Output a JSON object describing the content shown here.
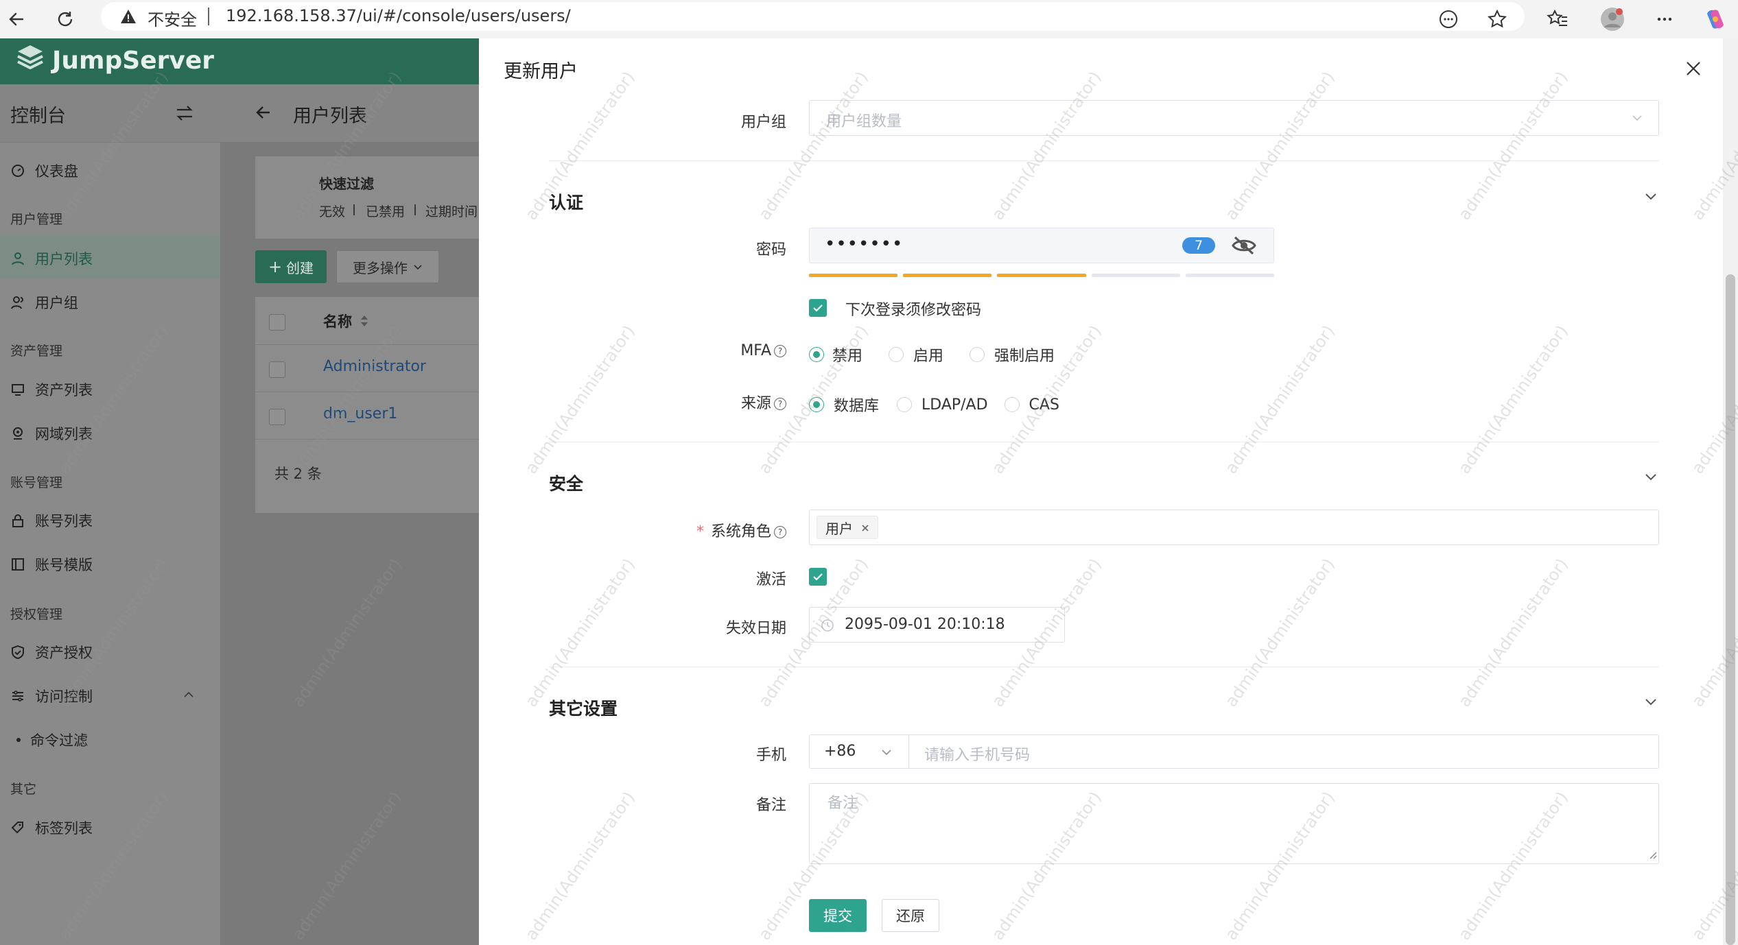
{
  "browser": {
    "security_label": "不安全",
    "url": "192.168.158.37/ui/#/console/users/users/"
  },
  "app": {
    "brand": "JumpServer",
    "console_title": "控制台",
    "page_title": "用户列表",
    "sidebar": {
      "dashboard": "仪表盘",
      "group_user_mgmt": "用户管理",
      "user_list": "用户列表",
      "user_group": "用户组",
      "group_asset_mgmt": "资产管理",
      "asset_list": "资产列表",
      "domain_list": "网域列表",
      "group_account_mgmt": "账号管理",
      "account_list": "账号列表",
      "account_template": "账号模版",
      "group_perm_mgmt": "授权管理",
      "asset_perm": "资产授权",
      "access_control": "访问控制",
      "command_filter": "命令过滤",
      "group_other": "其它",
      "tag_list": "标签列表"
    },
    "filter": {
      "title": "快速过滤",
      "items": [
        "无效",
        "已禁用",
        "过期时间"
      ]
    },
    "actions": {
      "create": "创建",
      "more": "更多操作"
    },
    "table": {
      "col_name": "名称",
      "rows": [
        "Administrator",
        "dm_user1"
      ],
      "total": "共 2 条"
    }
  },
  "drawer": {
    "title": "更新用户",
    "user_group": {
      "label": "用户组",
      "placeholder": "用户组数量"
    },
    "auth": {
      "title": "认证",
      "password_label": "密码",
      "password_value": "•••••••",
      "password_length": "7",
      "password_strength_filled": 3,
      "password_strength_total": 5,
      "must_change": "下次登录须修改密码",
      "must_change_checked": true,
      "mfa_label": "MFA",
      "mfa_options": [
        "禁用",
        "启用",
        "强制启用"
      ],
      "mfa_selected": "禁用",
      "source_label": "来源",
      "source_options": [
        "数据库",
        "LDAP/AD",
        "CAS"
      ],
      "source_selected": "数据库"
    },
    "security": {
      "title": "安全",
      "role_required_mark": "*",
      "role_label": "系统角色",
      "role_tag": "用户",
      "active_label": "激活",
      "active_checked": true,
      "expire_label": "失效日期",
      "expire_value": "2095-09-01 20:10:18"
    },
    "other": {
      "title": "其它设置",
      "phone_label": "手机",
      "phone_code": "+86",
      "phone_placeholder": "请输入手机号码",
      "remark_label": "备注",
      "remark_placeholder": "备注"
    },
    "buttons": {
      "submit": "提交",
      "reset": "还原"
    }
  },
  "watermark_text": "admin(Administrator)",
  "colors": {
    "brand_green": "#2a6b56",
    "accent_teal": "#2ea48f",
    "strength_orange": "#f5a623",
    "badge_blue": "#3d8fe0",
    "required_red": "#f56c6c"
  }
}
